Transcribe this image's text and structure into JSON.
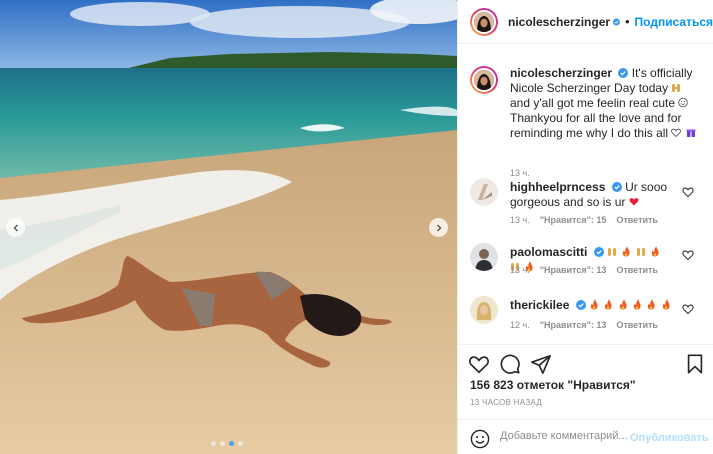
{
  "post": {
    "author": "nicolescherzinger",
    "follow_label": "Подписаться",
    "separator": "•",
    "photo_alt": "",
    "carousel_total": 4,
    "carousel_active": 3
  },
  "caption": {
    "username": "nicolescherzinger",
    "text_1": "It's officially Nicole Scherzinger Day today",
    "text_2": " and y'all got me feelin real cute ",
    "text_3": "Thankyou for all the love and for reminding me why I do this all ",
    "time": "13 ч."
  },
  "comments": [
    {
      "username": "highheelprncess",
      "text": "Ur sooo gorgeous and so is ur",
      "time": "13 ч.",
      "likes": "\"Нравится\": 15",
      "reply": "Ответить"
    },
    {
      "username": "paolomascitti",
      "text": "",
      "time": "13 ч.",
      "likes": "\"Нравится\": 13",
      "reply": "Ответить"
    },
    {
      "username": "therickilee",
      "text": "",
      "time": "12 ч.",
      "likes": "\"Нравится\": 13",
      "reply": "Ответить"
    }
  ],
  "actions": {
    "likes_count": "156 823 отметок \"Нравится\"",
    "post_time": "13 ЧАСОВ НАЗАД",
    "comment_placeholder": "Добавьте комментарий...",
    "publish_label": "Опубликовать"
  },
  "icons": {
    "like": "heart-outline-icon",
    "comment": "speech-bubble-icon",
    "share": "paper-plane-icon",
    "save": "bookmark-icon",
    "emoji": "smiley-icon",
    "verified": "verified-badge-icon"
  },
  "colors": {
    "link": "#0095f6",
    "verified": "#3897f0",
    "muted": "#8e8e8e",
    "border": "#efefef",
    "publish_disabled": "#b2dffc",
    "heart_red": "#ed1c3c"
  }
}
